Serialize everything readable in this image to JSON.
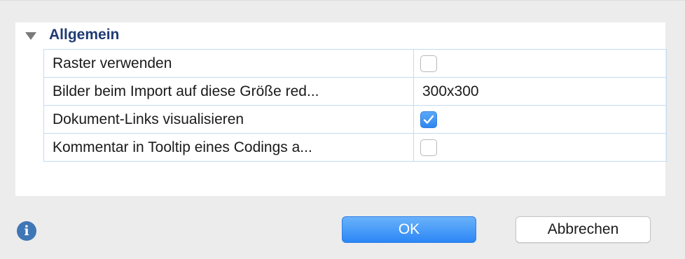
{
  "section": {
    "title": "Allgemein"
  },
  "settings": [
    {
      "label": "Raster verwenden",
      "type": "checkbox",
      "checked": false
    },
    {
      "label": "Bilder beim Import auf diese Größe red...",
      "type": "text",
      "value": "300x300"
    },
    {
      "label": "Dokument-Links visualisieren",
      "type": "checkbox",
      "checked": true
    },
    {
      "label": "Kommentar in Tooltip eines Codings a...",
      "type": "checkbox",
      "checked": false
    }
  ],
  "footer": {
    "info_icon": "info-icon",
    "ok_label": "OK",
    "cancel_label": "Abbrechen"
  },
  "colors": {
    "accent": "#2b86f5",
    "section_title": "#1f3b73",
    "grid_line": "#c6daf0"
  }
}
